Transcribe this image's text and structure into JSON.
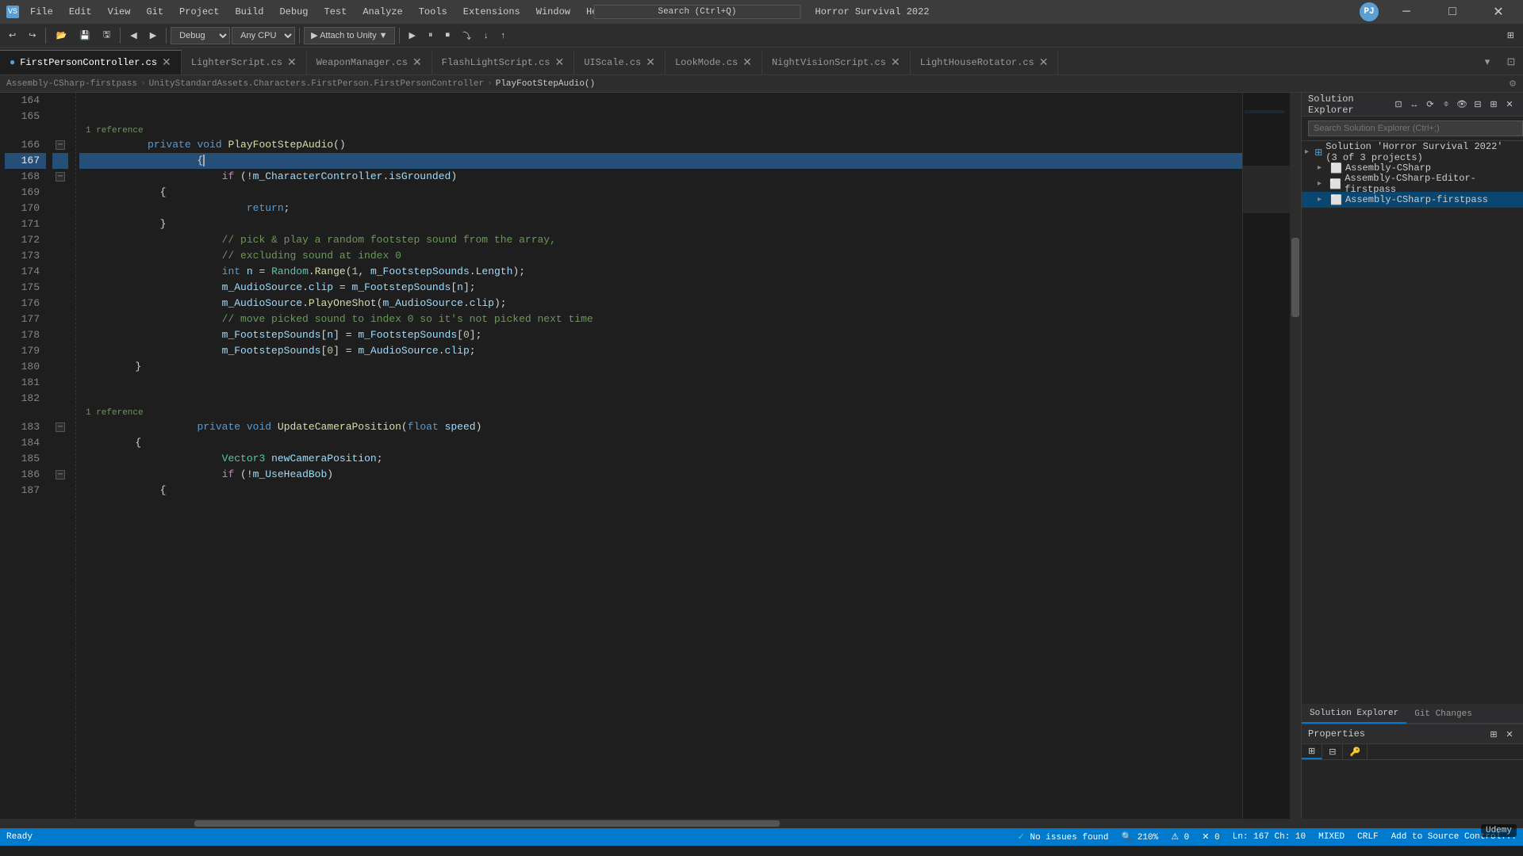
{
  "titleBar": {
    "menus": [
      "File",
      "Edit",
      "View",
      "Git",
      "Project",
      "Build",
      "Debug",
      "Test",
      "Analyze",
      "Tools",
      "Extensions",
      "Window",
      "Help"
    ],
    "appTitle": "Horror Survival 2022",
    "searchPlaceholder": "Search (Ctrl+Q)",
    "winBtns": [
      "─",
      "□",
      "✕"
    ],
    "profileIcon": "PJ"
  },
  "toolbar": {
    "undoLabel": "↩",
    "redoLabel": "↪",
    "debugConfig": "Debug",
    "cpuConfig": "Any CPU",
    "attachLabel": "▶ Attach to Unity",
    "buttons": [
      "◀",
      "▶",
      "⏸",
      "⏹",
      "🔄"
    ]
  },
  "tabs": [
    {
      "name": "FirstPersonController.cs",
      "active": true,
      "modified": false
    },
    {
      "name": "LighterScript.cs",
      "active": false
    },
    {
      "name": "WeaponManager.cs",
      "active": false
    },
    {
      "name": "FlashLightScript.cs",
      "active": false
    },
    {
      "name": "UIScale.cs",
      "active": false
    },
    {
      "name": "LookMode.cs",
      "active": false
    },
    {
      "name": "NightVisionScript.cs",
      "active": false
    },
    {
      "name": "LightHouseRotator.cs",
      "active": false
    }
  ],
  "breadcrumb": {
    "items": [
      "Assembly-CSharp-firstpass",
      "UnityStandardAssets.Characters.FirstPerson.FirstPersonController",
      "PlayFootStepAudio()"
    ]
  },
  "code": {
    "startLine": 164,
    "activeLine": 167,
    "lines": [
      {
        "num": 164,
        "content": "",
        "tokens": []
      },
      {
        "num": 165,
        "content": "",
        "tokens": []
      },
      {
        "num": 166,
        "content": "        1 reference",
        "tokens": [
          {
            "t": "cmt",
            "v": "        1 reference"
          }
        ],
        "isRef": true,
        "hasCollapse": true
      },
      {
        "num": 166,
        "content": "        private void PlayFootStepAudio()",
        "tokens": [
          {
            "t": "kw",
            "v": "        private"
          },
          {
            "t": "plain",
            "v": " "
          },
          {
            "t": "kw",
            "v": "void"
          },
          {
            "t": "plain",
            "v": " "
          },
          {
            "t": "fn",
            "v": "PlayFootStepAudio"
          },
          {
            "t": "plain",
            "v": "()"
          }
        ],
        "showLineNum": true
      },
      {
        "num": 167,
        "content": "        {",
        "tokens": [
          {
            "t": "plain",
            "v": "        {"
          }
        ],
        "active": true
      },
      {
        "num": 168,
        "content": "            if (!m_CharacterController.isGrounded)",
        "tokens": [
          {
            "t": "plain",
            "v": "            "
          },
          {
            "t": "kw2",
            "v": "if"
          },
          {
            "t": "plain",
            "v": " (!"
          },
          {
            "t": "var",
            "v": "m_CharacterController"
          },
          {
            "t": "plain",
            "v": "."
          },
          {
            "t": "prop",
            "v": "isGrounded"
          },
          {
            "t": "plain",
            "v": ")"
          }
        ],
        "hasCollapse": true
      },
      {
        "num": 169,
        "content": "            {",
        "tokens": [
          {
            "t": "plain",
            "v": "            {"
          }
        ]
      },
      {
        "num": 170,
        "content": "                return;",
        "tokens": [
          {
            "t": "plain",
            "v": "                "
          },
          {
            "t": "kw",
            "v": "return"
          },
          {
            "t": "plain",
            "v": ";"
          }
        ]
      },
      {
        "num": 171,
        "content": "            }",
        "tokens": [
          {
            "t": "plain",
            "v": "            }"
          }
        ]
      },
      {
        "num": 172,
        "content": "            // pick & play a random footstep sound from the array,",
        "tokens": [
          {
            "t": "cmt",
            "v": "            // pick & play a random footstep sound from the array,"
          }
        ]
      },
      {
        "num": 173,
        "content": "            // excluding sound at index 0",
        "tokens": [
          {
            "t": "cmt",
            "v": "            // excluding sound at index 0"
          }
        ]
      },
      {
        "num": 174,
        "content": "            int n = Random.Range(1, m_FootstepSounds.Length);",
        "tokens": [
          {
            "t": "plain",
            "v": "            "
          },
          {
            "t": "kw",
            "v": "int"
          },
          {
            "t": "plain",
            "v": " "
          },
          {
            "t": "var",
            "v": "n"
          },
          {
            "t": "plain",
            "v": " = "
          },
          {
            "t": "type",
            "v": "Random"
          },
          {
            "t": "plain",
            "v": "."
          },
          {
            "t": "fn",
            "v": "Range"
          },
          {
            "t": "plain",
            "v": "("
          },
          {
            "t": "num",
            "v": "1"
          },
          {
            "t": "plain",
            "v": ", "
          },
          {
            "t": "var",
            "v": "m_FootstepSounds"
          },
          {
            "t": "plain",
            "v": "."
          },
          {
            "t": "prop",
            "v": "Length"
          },
          {
            "t": "plain",
            "v": ");"
          }
        ]
      },
      {
        "num": 175,
        "content": "            m_AudioSource.clip = m_FootstepSounds[n];",
        "tokens": [
          {
            "t": "plain",
            "v": "            "
          },
          {
            "t": "var",
            "v": "m_AudioSource"
          },
          {
            "t": "plain",
            "v": "."
          },
          {
            "t": "prop",
            "v": "clip"
          },
          {
            "t": "plain",
            "v": " = "
          },
          {
            "t": "var",
            "v": "m_FootstepSounds"
          },
          {
            "t": "plain",
            "v": "["
          },
          {
            "t": "var",
            "v": "n"
          },
          {
            "t": "plain",
            "v": "];"
          }
        ]
      },
      {
        "num": 176,
        "content": "            m_AudioSource.PlayOneShot(m_AudioSource.clip);",
        "tokens": [
          {
            "t": "plain",
            "v": "            "
          },
          {
            "t": "var",
            "v": "m_AudioSource"
          },
          {
            "t": "plain",
            "v": "."
          },
          {
            "t": "fn",
            "v": "PlayOneShot"
          },
          {
            "t": "plain",
            "v": "("
          },
          {
            "t": "var",
            "v": "m_AudioSource"
          },
          {
            "t": "plain",
            "v": "."
          },
          {
            "t": "prop",
            "v": "clip"
          },
          {
            "t": "plain",
            "v": ");"
          }
        ]
      },
      {
        "num": 177,
        "content": "            // move picked sound to index 0 so it's not picked next time",
        "tokens": [
          {
            "t": "cmt",
            "v": "            // move picked sound to index 0 so it's not picked next time"
          }
        ]
      },
      {
        "num": 178,
        "content": "            m_FootstepSounds[n] = m_FootstepSounds[0];",
        "tokens": [
          {
            "t": "plain",
            "v": "            "
          },
          {
            "t": "var",
            "v": "m_FootstepSounds"
          },
          {
            "t": "plain",
            "v": "["
          },
          {
            "t": "var",
            "v": "n"
          },
          {
            "t": "plain",
            "v": "] = "
          },
          {
            "t": "var",
            "v": "m_FootstepSounds"
          },
          {
            "t": "plain",
            "v": "["
          },
          {
            "t": "num",
            "v": "0"
          },
          {
            "t": "plain",
            "v": "];"
          }
        ]
      },
      {
        "num": 179,
        "content": "            m_FootstepSounds[0] = m_AudioSource.clip;",
        "tokens": [
          {
            "t": "plain",
            "v": "            "
          },
          {
            "t": "var",
            "v": "m_FootstepSounds"
          },
          {
            "t": "plain",
            "v": "["
          },
          {
            "t": "num",
            "v": "0"
          },
          {
            "t": "plain",
            "v": "] = "
          },
          {
            "t": "var",
            "v": "m_AudioSource"
          },
          {
            "t": "plain",
            "v": "."
          },
          {
            "t": "prop",
            "v": "clip"
          },
          {
            "t": "plain",
            "v": ";"
          }
        ]
      },
      {
        "num": 180,
        "content": "        }",
        "tokens": [
          {
            "t": "plain",
            "v": "        }"
          }
        ]
      },
      {
        "num": 181,
        "content": "",
        "tokens": []
      },
      {
        "num": 182,
        "content": "",
        "tokens": []
      },
      {
        "num": 183,
        "content": "        1 reference",
        "tokens": [
          {
            "t": "cmt",
            "v": "        1 reference"
          }
        ],
        "isRef": true,
        "hasCollapse": true
      },
      {
        "num": 183,
        "content": "        private void UpdateCameraPosition(float speed)",
        "tokens": [
          {
            "t": "plain",
            "v": "        "
          },
          {
            "t": "kw",
            "v": "private"
          },
          {
            "t": "plain",
            "v": " "
          },
          {
            "t": "kw",
            "v": "void"
          },
          {
            "t": "plain",
            "v": " "
          },
          {
            "t": "fn",
            "v": "UpdateCameraPosition"
          },
          {
            "t": "plain",
            "v": "("
          },
          {
            "t": "kw",
            "v": "float"
          },
          {
            "t": "plain",
            "v": " "
          },
          {
            "t": "var",
            "v": "speed"
          },
          {
            "t": "plain",
            "v": ")"
          }
        ],
        "showLineNum": true
      },
      {
        "num": 184,
        "content": "        {",
        "tokens": [
          {
            "t": "plain",
            "v": "        {"
          }
        ]
      },
      {
        "num": 185,
        "content": "            Vector3 newCameraPosition;",
        "tokens": [
          {
            "t": "plain",
            "v": "            "
          },
          {
            "t": "type",
            "v": "Vector3"
          },
          {
            "t": "plain",
            "v": " "
          },
          {
            "t": "var",
            "v": "newCameraPosition"
          },
          {
            "t": "plain",
            "v": ";"
          }
        ]
      },
      {
        "num": 186,
        "content": "            if (!m_UseHeadBob)",
        "tokens": [
          {
            "t": "plain",
            "v": "            "
          },
          {
            "t": "kw2",
            "v": "if"
          },
          {
            "t": "plain",
            "v": " (!"
          },
          {
            "t": "var",
            "v": "m_UseHeadBob"
          },
          {
            "t": "plain",
            "v": ")"
          }
        ],
        "hasCollapse": true
      },
      {
        "num": 187,
        "content": "            {",
        "tokens": [
          {
            "t": "plain",
            "v": "            {"
          }
        ]
      }
    ]
  },
  "solutionExplorer": {
    "title": "Solution Explorer",
    "searchPlaceholder": "Search Solution Explorer (Ctrl+;)",
    "solution": "Solution 'Horror Survival 2022' (3 of 3 projects)",
    "items": [
      {
        "name": "Assembly-CSharp",
        "level": 1,
        "expanded": false
      },
      {
        "name": "Assembly-CSharp-Editor-firstpass",
        "level": 1,
        "expanded": false
      },
      {
        "name": "Assembly-CSharp-firstpass",
        "level": 1,
        "expanded": false,
        "selected": true
      }
    ],
    "panelTabs": [
      "Solution Explorer",
      "Git Changes"
    ]
  },
  "properties": {
    "title": "Properties",
    "tabs": [
      "⚙",
      "🔧",
      "🔑"
    ]
  },
  "statusBar": {
    "ready": "Ready",
    "noIssues": "No issues found",
    "zoom": "210%",
    "lineCol": "Ln: 167  Ch: 10",
    "encoding": "MIXED",
    "lineEnding": "CRLF",
    "addSourceControl": "Add to Source Control...",
    "udemy": "Udemy"
  },
  "horizontalScroll": {
    "position": 0
  }
}
